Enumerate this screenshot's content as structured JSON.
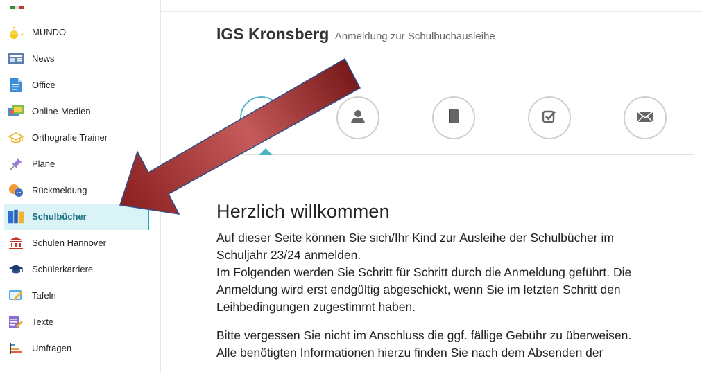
{
  "sidebar": {
    "items": [
      {
        "label": "MUNDO",
        "icon": "mundo-sun-icon",
        "active": false
      },
      {
        "label": "News",
        "icon": "news-icon",
        "active": false
      },
      {
        "label": "Office",
        "icon": "office-document-icon",
        "active": false
      },
      {
        "label": "Online-Medien",
        "icon": "online-media-icon",
        "active": false
      },
      {
        "label": "Orthografie Trainer",
        "icon": "graduation-cap-icon",
        "active": false
      },
      {
        "label": "Pläne",
        "icon": "pushpin-icon",
        "active": false
      },
      {
        "label": "Rückmeldung",
        "icon": "feedback-chat-icon",
        "active": false
      },
      {
        "label": "Schulbücher",
        "icon": "books-icon",
        "active": true
      },
      {
        "label": "Schulen Hannover",
        "icon": "school-building-icon",
        "active": false
      },
      {
        "label": "Schülerkarriere",
        "icon": "mortarboard-icon",
        "active": false
      },
      {
        "label": "Tafeln",
        "icon": "whiteboard-icon",
        "active": false
      },
      {
        "label": "Texte",
        "icon": "text-edit-icon",
        "active": false
      },
      {
        "label": "Umfragen",
        "icon": "poll-chart-icon",
        "active": false
      }
    ]
  },
  "header": {
    "school": "IGS Kronsberg",
    "subtitle": "Anmeldung zur Schulbuchausleihe"
  },
  "steps": [
    {
      "icon": "start-step-icon",
      "active": true
    },
    {
      "icon": "user-icon",
      "active": false
    },
    {
      "icon": "book-icon",
      "active": false
    },
    {
      "icon": "checkbox-icon",
      "active": false
    },
    {
      "icon": "envelope-icon",
      "active": false
    }
  ],
  "content": {
    "heading": "Herzlich willkommen",
    "p1_line1": "Auf dieser Seite können Sie sich/Ihr Kind zur Ausleihe der Schulbücher im",
    "p1_schuljahr": "Schuljahr 23/24",
    "p1_line2_rest": " anmelden.",
    "p1_line3": "Im Folgenden werden Sie Schritt für Schritt durch die Anmeldung geführt. Die",
    "p1_line4": "Anmeldung wird erst endgültig abgeschickt, wenn Sie im letzten Schritt den",
    "p1_line5": "Leihbedingungen zugestimmt haben.",
    "p2_line1": "Bitte vergessen Sie nicht im Anschluss die ggf. fällige Gebühr zu überweisen.",
    "p2_line2": "Alle benötigten Informationen hierzu finden Sie nach dem Absenden der"
  },
  "colors": {
    "accent": "#2aa3b8",
    "active_bg": "#d9f3f7",
    "arrow": "#a52a2a"
  }
}
